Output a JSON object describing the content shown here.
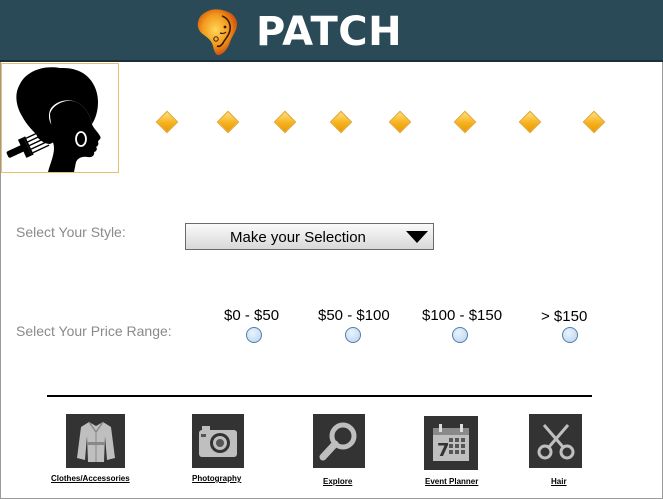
{
  "header": {
    "title": "PATCH",
    "logo": "africa-face-logo-icon"
  },
  "profile": {
    "icon": "afro-silhouette-with-pick-icon"
  },
  "progress_steps": {
    "count_icon": "diamond-icon",
    "steps": [
      "",
      "",
      "",
      "",
      "",
      "",
      "",
      ""
    ]
  },
  "style_selector": {
    "label": "Select Your Style:",
    "selected": "Make your Selection"
  },
  "price_range": {
    "label": "Select Your Price Range:",
    "options": [
      "$0 - $50",
      "$50 - $100",
      "$100 - $150",
      "> $150"
    ]
  },
  "nav": [
    {
      "label": "Clothes/Accessories",
      "icon": "jacket-icon"
    },
    {
      "label": "Photography",
      "icon": "camera-icon"
    },
    {
      "label": "Explore",
      "icon": "magnifier-icon"
    },
    {
      "label": "Event Planner",
      "icon": "calendar-icon"
    },
    {
      "label": "Hair",
      "icon": "scissors-icon"
    }
  ],
  "colors": {
    "header_bg": "#2b4a57",
    "diamond": "#f6b21c",
    "radio_border": "#4f7fb0"
  }
}
